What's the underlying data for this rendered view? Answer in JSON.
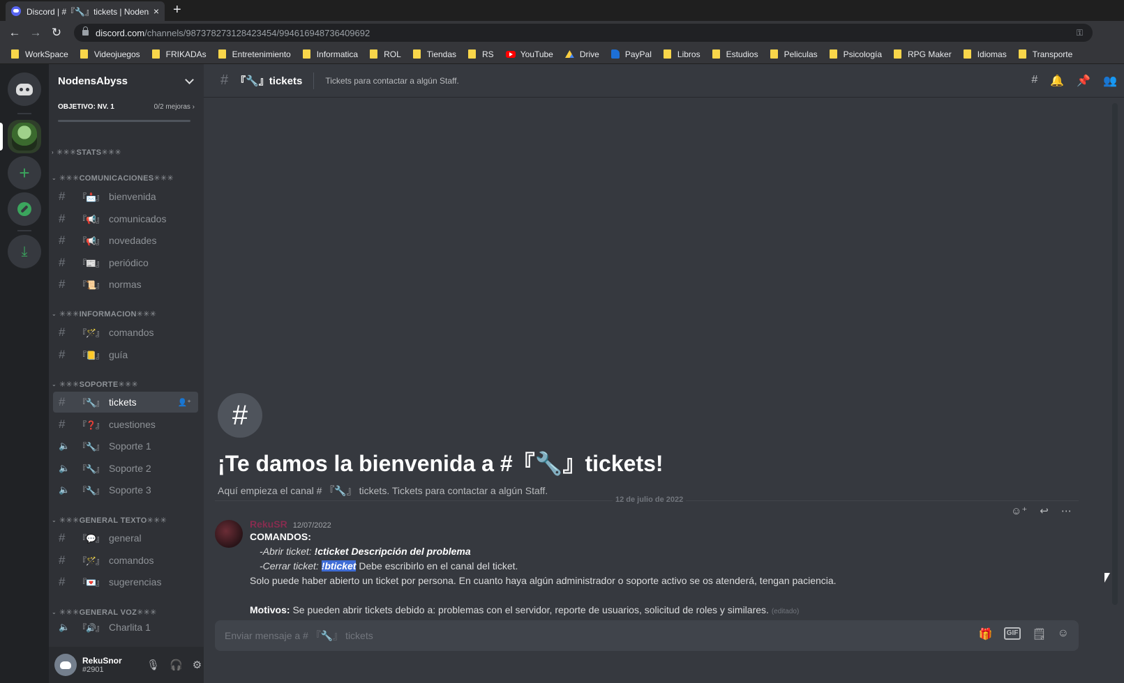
{
  "browser": {
    "tab_title": "Discord | #『🔧』tickets | Nodens/",
    "tab_close": "×",
    "new_tab": "+",
    "url_host": "discord.com",
    "url_path": "/channels/987378273128423454/994616948736409692",
    "bookmarks": [
      "WorkSpace",
      "Videojuegos",
      "FRIKADAs",
      "Entretenimiento",
      "Informatica",
      "ROL",
      "Tiendas",
      "RS",
      "YouTube",
      "Drive",
      "PayPal",
      "Libros",
      "Estudios",
      "Peliculas",
      "Psicología",
      "RPG Maker",
      "Idiomas",
      "Transporte"
    ]
  },
  "server": {
    "name": "NodensAbyss",
    "boost_goal": "OBJETIVO: NV. 1",
    "boost_progress": "0/2 mejoras"
  },
  "categories": {
    "stats": "✳✳✳STATS✳✳✳",
    "comunicaciones": "✳✳✳COMUNICACIONES✳✳✳",
    "informacion": "✳✳✳INFORMACION✳✳✳",
    "soporte": "✳✳✳SOPORTE✳✳✳",
    "general_texto": "✳✳✳GENERAL TEXTO✳✳✳",
    "general_voz": "✳✳✳GENERAL VOZ✳✳✳"
  },
  "channels": {
    "bienvenida": "bienvenida",
    "comunicados": "comunicados",
    "novedades": "novedades",
    "periodico": "periódico",
    "normas": "normas",
    "comandos_info": "comandos",
    "guia": "guía",
    "tickets": "tickets",
    "cuestiones": "cuestiones",
    "soporte1": "Soporte 1",
    "soporte2": "Soporte 2",
    "soporte3": "Soporte 3",
    "general": "general",
    "comandos_gen": "comandos",
    "sugerencias": "sugerencias",
    "charlita1": "Charlita 1"
  },
  "user": {
    "name": "RekuSnor",
    "discriminator": "#2901"
  },
  "header": {
    "channel_name": "『🔧』tickets",
    "topic": "Tickets para contactar a algún Staff."
  },
  "welcome": {
    "title": "¡Te damos la bienvenida a #『🔧』tickets!",
    "subtitle": "Aquí empieza el canal # 『🔧』 tickets. Tickets para contactar a algún Staff."
  },
  "divider_date": "12 de julio de 2022",
  "message": {
    "author": "RekuSR",
    "timestamp": "12/07/2022",
    "heading": "COMANDOS:",
    "open_label": "-Abrir ticket: ",
    "open_cmd": "!cticket Descripción del problema",
    "close_label": "-Cerrar ticket: ",
    "close_cmd": "!bticket",
    "close_note": " Debe escribirlo en el canal del ticket.",
    "rule": "Solo puede haber abierto un ticket por persona. En cuanto haya algún administrador o soporte activo se os atenderá, tengan paciencia.",
    "motivos_label": "Motivos:",
    "motivos_text": " Se pueden abrir tickets debido a: problemas con el servidor, reporte de usuarios, solicitud de roles y similares.",
    "edited": "(editado)"
  },
  "composer": {
    "placeholder": "Enviar mensaje a # 『🔧』 tickets",
    "gif_label": "GIF"
  }
}
